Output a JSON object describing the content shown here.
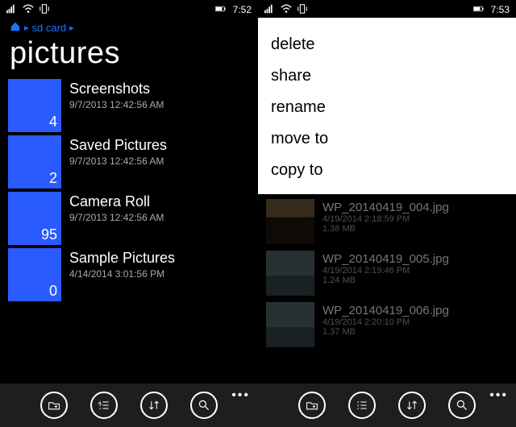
{
  "left": {
    "status": {
      "time": "7:52"
    },
    "breadcrumb": {
      "root_icon": "home",
      "path": "sd card",
      "caret": "▸"
    },
    "title": "pictures",
    "folders": [
      {
        "name": "Screenshots",
        "date": "9/7/2013 12:42:56 AM",
        "count": "4"
      },
      {
        "name": "Saved Pictures",
        "date": "9/7/2013 12:42:56 AM",
        "count": "2"
      },
      {
        "name": "Camera Roll",
        "date": "9/7/2013 12:42:56 AM",
        "count": "95"
      },
      {
        "name": "Sample Pictures",
        "date": "4/14/2014 3:01:56 PM",
        "count": "0"
      }
    ]
  },
  "right": {
    "status": {
      "time": "7:53"
    },
    "menu": {
      "items": [
        "delete",
        "share",
        "rename",
        "move to",
        "copy to"
      ]
    },
    "files": [
      {
        "name": "WP_20140419_004.jpg",
        "date": "4/19/2014 2:18:59 PM",
        "size": "1.38 MB"
      },
      {
        "name": "WP_20140419_005.jpg",
        "date": "4/19/2014 2:19:46 PM",
        "size": "1.24 MB"
      },
      {
        "name": "WP_20140419_006.jpg",
        "date": "4/19/2014 2:20:10 PM",
        "size": "1.37 MB"
      }
    ]
  },
  "appbar": {
    "icons": [
      "new-folder",
      "select",
      "sort",
      "search"
    ],
    "more": "•••"
  },
  "colors": {
    "accent": "#2a5bff",
    "link": "#1a73ff"
  }
}
